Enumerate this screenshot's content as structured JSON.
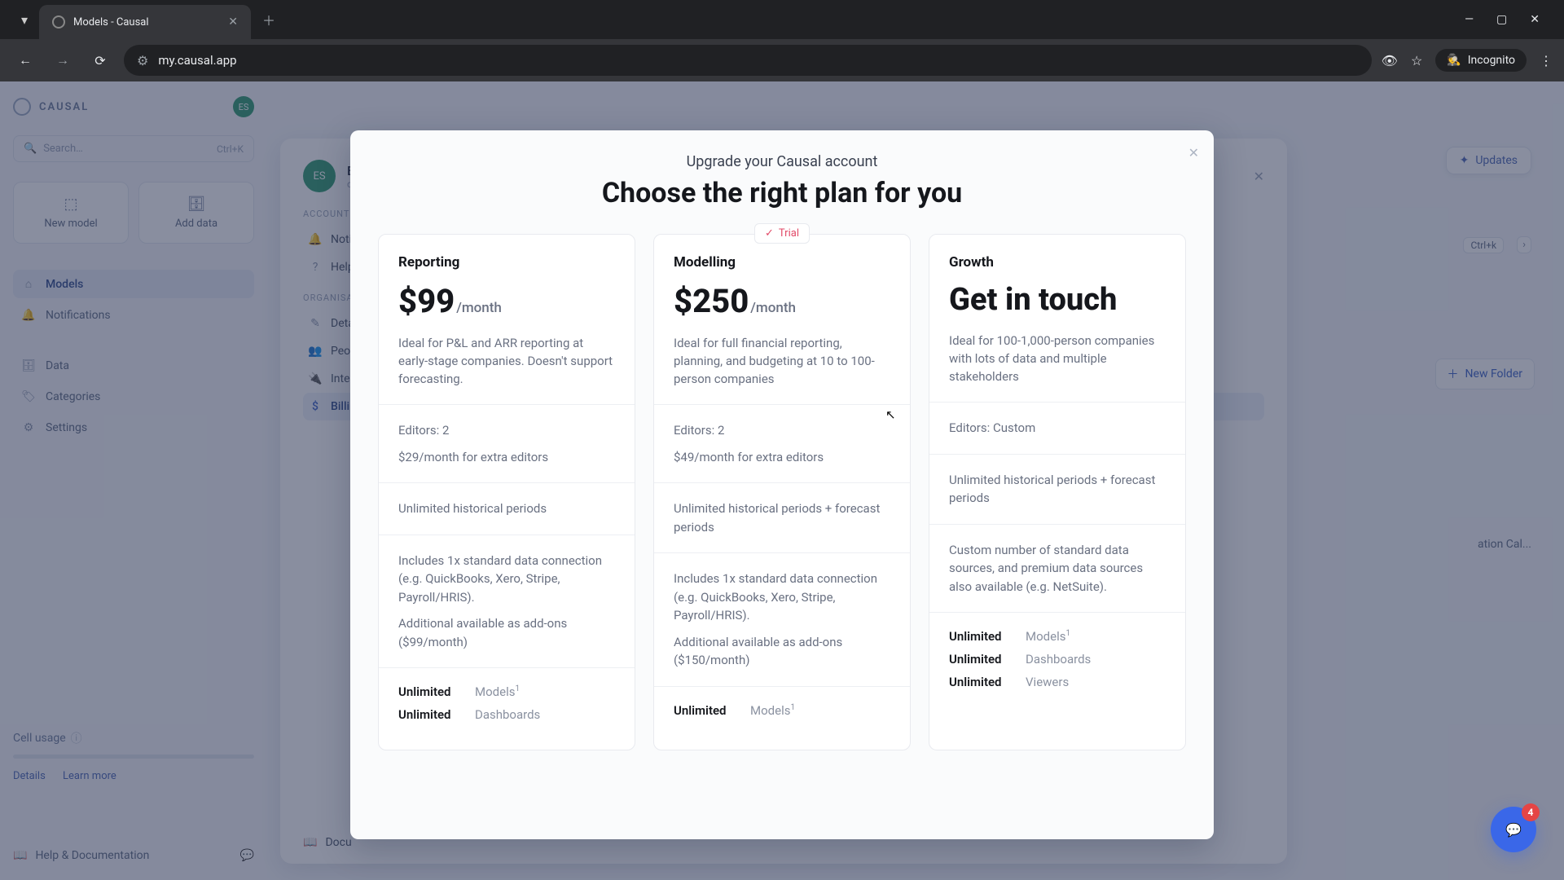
{
  "browser": {
    "tab_title": "Models - Causal",
    "url": "my.causal.app",
    "incognito_label": "Incognito"
  },
  "brand": {
    "name": "CAUSAL",
    "avatar": "ES"
  },
  "search": {
    "placeholder": "Search…",
    "shortcut": "Ctrl+K"
  },
  "quick": {
    "new_model": "New model",
    "add_data": "Add data"
  },
  "nav": {
    "models": "Models",
    "notifications": "Notifications",
    "data": "Data",
    "categories": "Categories",
    "settings": "Settings"
  },
  "cell_usage": {
    "label": "Cell usage",
    "details": "Details",
    "learn": "Learn more"
  },
  "help_doc": "Help & Documentation",
  "mid_panel": {
    "avatar": "ES",
    "name_initial": "E",
    "email_initial": "d",
    "section_account": "ACCOUNT",
    "notif": "Notif",
    "help": "Help",
    "section_org": "ORGANISA",
    "deta": "Deta",
    "peop": "Peop",
    "integ": "Integ",
    "billing": "Billing",
    "docu": "Docu"
  },
  "right_peek": {
    "updates": "Updates",
    "shortcut": "Ctrl+k",
    "new_folder": "New Folder",
    "folder_hint": "ation Cal..."
  },
  "modal": {
    "subtitle": "Upgrade your Causal account",
    "title": "Choose the right plan for you",
    "trial_label": "Trial",
    "plans": [
      {
        "name": "Reporting",
        "price": "$99",
        "period": "/month",
        "desc": "Ideal for P&L and ARR reporting at early-stage companies. Doesn't support forecasting.",
        "editors": "Editors: 2",
        "extra_editors": "$29/month for extra editors",
        "periods": "Unlimited historical periods",
        "data_conn": "Includes 1x standard data connection (e.g. QuickBooks, Xero, Stripe, Payroll/HRIS).",
        "addons": "Additional available as add-ons ($99/month)",
        "limits": [
          {
            "k": "Unlimited",
            "v": "Models",
            "sup": "1"
          },
          {
            "k": "Unlimited",
            "v": "Dashboards"
          }
        ]
      },
      {
        "name": "Modelling",
        "price": "$250",
        "period": "/month",
        "desc": "Ideal for full financial reporting, planning, and budgeting at 10 to 100-person companies",
        "editors": "Editors: 2",
        "extra_editors": "$49/month for extra editors",
        "periods": "Unlimited historical periods + forecast periods",
        "data_conn": "Includes 1x standard data connection (e.g. QuickBooks, Xero, Stripe, Payroll/HRIS).",
        "addons": "Additional available as add-ons ($150/month)",
        "limits": [
          {
            "k": "Unlimited",
            "v": "Models",
            "sup": "1"
          }
        ]
      },
      {
        "name": "Growth",
        "price_text": "Get in touch",
        "desc": "Ideal for 100-1,000-person companies with lots of data and multiple stakeholders",
        "editors": "Editors: Custom",
        "periods": "Unlimited historical periods + forecast periods",
        "data_conn": "Custom number of standard data sources, and premium data sources also available (e.g. NetSuite).",
        "limits": [
          {
            "k": "Unlimited",
            "v": "Models",
            "sup": "1"
          },
          {
            "k": "Unlimited",
            "v": "Dashboards"
          },
          {
            "k": "Unlimited",
            "v": "Viewers"
          }
        ]
      }
    ]
  },
  "chat": {
    "badge": "4"
  }
}
